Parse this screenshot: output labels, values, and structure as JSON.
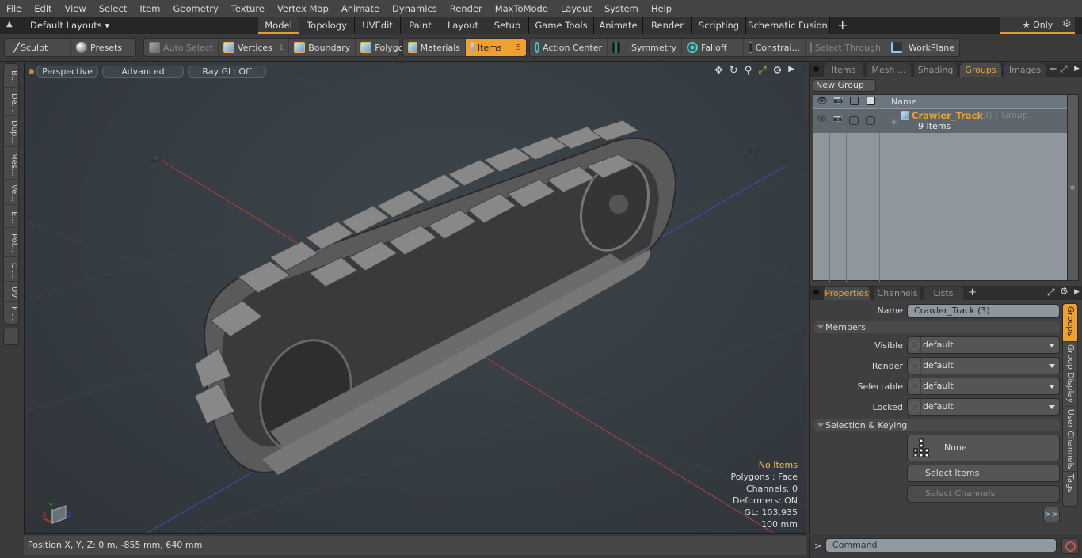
{
  "menu": [
    "File",
    "Edit",
    "View",
    "Select",
    "Item",
    "Geometry",
    "Texture",
    "Vertex Map",
    "Animate",
    "Dynamics",
    "Render",
    "MaxToModo",
    "Layout",
    "System",
    "Help"
  ],
  "layoutbar": {
    "layout_select": "Default Layouts ▾",
    "tabs": [
      {
        "label": "Model",
        "active": true
      },
      {
        "label": "Topology"
      },
      {
        "label": "UVEdit"
      },
      {
        "label": "Paint"
      },
      {
        "label": "Layout"
      },
      {
        "label": "Setup"
      },
      {
        "label": "Game Tools"
      },
      {
        "label": "Animate"
      },
      {
        "label": "Render"
      },
      {
        "label": "Scripting"
      },
      {
        "label": "Schematic Fusion"
      }
    ],
    "add": "+",
    "only": "★ Only",
    "gear": "⚙"
  },
  "toolbar": {
    "sculpt": "Sculpt",
    "presets": "Presets",
    "auto_select": "Auto Select",
    "vertices": "Vertices",
    "vertices_count": "1",
    "boundary": "Boundary",
    "polygons": "Polygons",
    "materials": "Materials",
    "items": "Items",
    "items_count": "5",
    "action_center": "Action Center",
    "symmetry": "Symmetry",
    "falloff": "Falloff",
    "constraints": "Constrai...",
    "select_through": "Select Through",
    "workplane": "WorkPlane"
  },
  "left_tabs": [
    "B...",
    "De...",
    "Dup...",
    "Mes...",
    "Ve...",
    "E...",
    "Pol...",
    "C ...",
    "UV",
    "F ..."
  ],
  "viewport": {
    "perspective": "Perspective",
    "advanced": "Advanced",
    "raygl": "Ray GL: Off",
    "info": {
      "selection": "No Items",
      "polygons": "Polygons : Face",
      "channels": "Channels: 0",
      "deformers": "Deformers: ON",
      "gl": "GL: 103,935",
      "scale": "100 mm"
    },
    "axis_labels": {
      "x": "X",
      "y": "Y",
      "z": "Z"
    },
    "model": "Crawler Track"
  },
  "status": {
    "position": "Position X, Y, Z:   0 m, -855 mm, 640 mm"
  },
  "groups_panel": {
    "tabs": [
      {
        "label": "Items"
      },
      {
        "label": "Mesh ..."
      },
      {
        "label": "Shading"
      },
      {
        "label": "Groups",
        "active": true
      },
      {
        "label": "Images"
      }
    ],
    "new_group": "New Group",
    "column_name": "Name",
    "rows": [
      {
        "name": "Crawler_Track",
        "suffix": "(3)",
        "type": ": Group",
        "count": "9 Items"
      }
    ]
  },
  "properties": {
    "tabs": [
      {
        "label": "Properties",
        "active": true
      },
      {
        "label": "Channels"
      },
      {
        "label": "Lists"
      }
    ],
    "name_label": "Name",
    "name_value": "Crawler_Track (3)",
    "members_section": "Members",
    "fields": [
      {
        "label": "Visible",
        "value": "default"
      },
      {
        "label": "Render",
        "value": "default"
      },
      {
        "label": "Selectable",
        "value": "default"
      },
      {
        "label": "Locked",
        "value": "default"
      }
    ],
    "selection_section": "Selection & Keying",
    "none_button": "None",
    "select_items": "Select Items",
    "select_channels": "Select Channels",
    "more": ">>",
    "side_tabs": [
      {
        "label": "Groups",
        "active": true
      },
      {
        "label": "Group Display"
      },
      {
        "label": "User Channels"
      },
      {
        "label": "Tags"
      }
    ]
  },
  "command": {
    "prompt": ">",
    "placeholder": "Command"
  }
}
